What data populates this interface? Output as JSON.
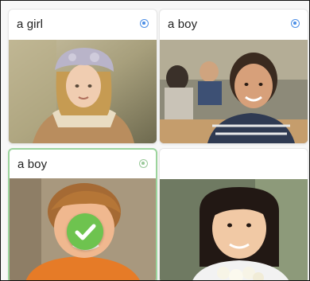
{
  "cards": [
    {
      "label": "a girl",
      "audio_icon": "audio-play-icon",
      "selected": false
    },
    {
      "label": "a boy",
      "audio_icon": "audio-play-icon",
      "selected": false
    },
    {
      "label": "a boy",
      "audio_icon": "audio-play-icon",
      "selected": true
    },
    {
      "label": "",
      "audio_icon": "",
      "selected": false
    }
  ],
  "colors": {
    "accent_blue": "#4d8fe6",
    "selected_green": "#6ec34f",
    "selected_border": "#9bd49c"
  },
  "icons": {
    "check": "check-icon"
  }
}
